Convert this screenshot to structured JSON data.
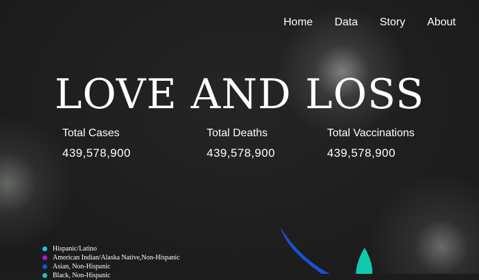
{
  "nav": {
    "items": [
      "Home",
      "Data",
      "Story",
      "About"
    ]
  },
  "hero": {
    "title": "LOVE AND LOSS"
  },
  "stats": [
    {
      "label": "Total Cases",
      "value": "439,578,900"
    },
    {
      "label": "Total Deaths",
      "value": "439,578,900"
    },
    {
      "label": "Total Vaccinations",
      "value": "439,578,900"
    }
  ],
  "legend": {
    "items": [
      {
        "label": "Hispanic/Latino",
        "color": "#19c3e6"
      },
      {
        "label": "American Indian/Alaska Native,Non-Hispanic",
        "color": "#9c1fd6"
      },
      {
        "label": "Asian, Non-Hispanic",
        "color": "#1c4fe0"
      },
      {
        "label": "Black, Non-Hispanic",
        "color": "#12c9b4"
      }
    ]
  },
  "colors": {
    "background": "#1c1c1c",
    "petal_blue": "#1b4fd9",
    "petal_teal": "#10c9b0"
  }
}
